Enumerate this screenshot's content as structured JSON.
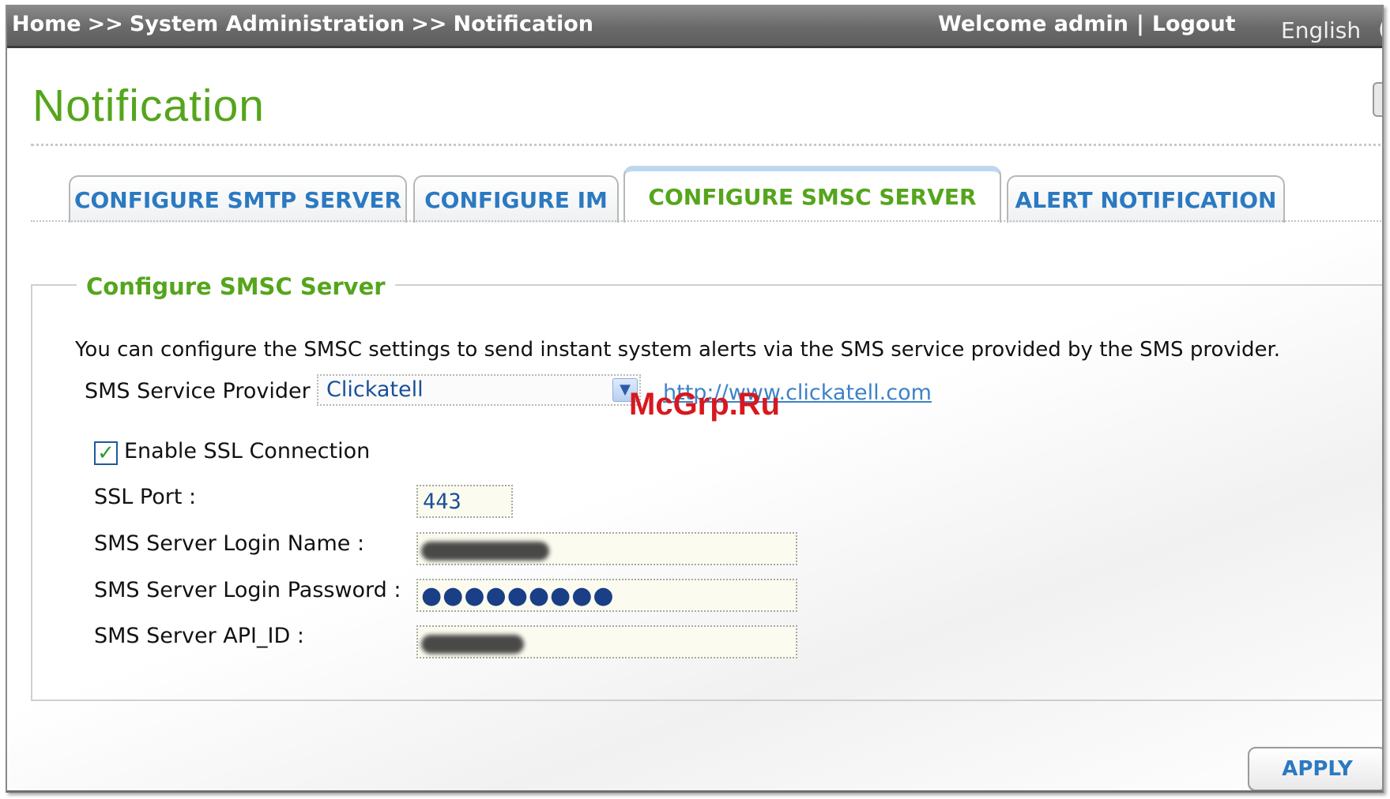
{
  "header": {
    "breadcrumb": [
      "Home",
      "System Administration",
      "Notification"
    ],
    "breadcrumb_sep": ">>",
    "welcome": "Welcome admin",
    "divider": "|",
    "logout": "Logout",
    "language": "English",
    "language_cut": "("
  },
  "page": {
    "title": "Notification"
  },
  "tabs": [
    {
      "label": "CONFIGURE SMTP SERVER",
      "active": false
    },
    {
      "label": "CONFIGURE IM",
      "active": false
    },
    {
      "label": "CONFIGURE SMSC SERVER",
      "active": true
    },
    {
      "label": "ALERT NOTIFICATION",
      "active": false
    }
  ],
  "section": {
    "legend": "Configure SMSC Server",
    "description": "You can configure the SMSC settings to send instant system alerts via the SMS service provided by the SMS provider."
  },
  "form": {
    "provider_label": "SMS Service Provider",
    "provider_value": "Clickatell",
    "provider_link": "http://www.clickatell.com",
    "ssl_label": "Enable SSL Connection",
    "ssl_checked": true,
    "checkmark": "✓",
    "port_label": "SSL Port :",
    "port_value": "443",
    "login_label": "SMS Server Login Name :",
    "password_label": "SMS Server Login Password :",
    "password_mask": "●●●●●●●●●",
    "api_label": "SMS Server API_ID :"
  },
  "watermark": "McGrp.Ru",
  "actions": {
    "apply": "APPLY"
  },
  "colors": {
    "accent_green": "#55a51c",
    "tab_blue": "#2b79c1",
    "link_blue": "#3c82c8",
    "watermark_red": "#d7181f"
  },
  "icons": {
    "select_arrow": "chevron-down-icon",
    "checkbox": "check-icon"
  }
}
